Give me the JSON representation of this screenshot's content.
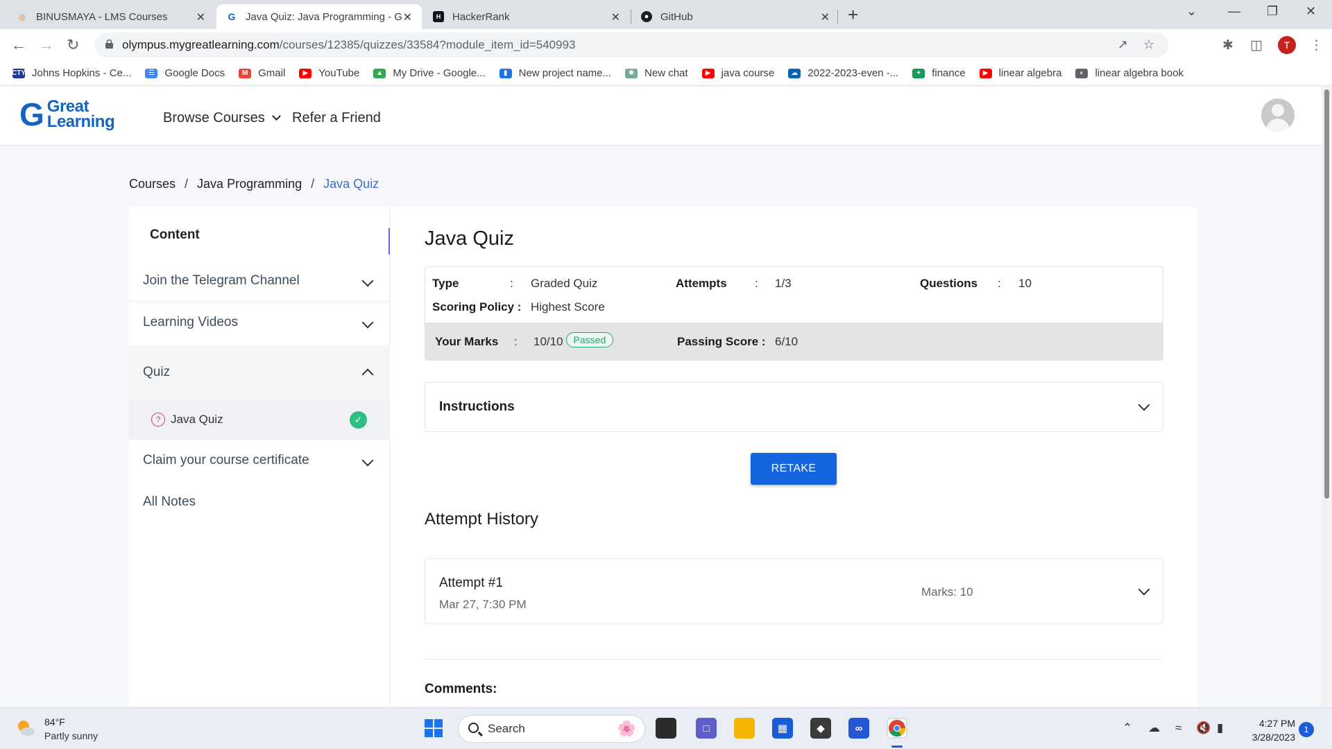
{
  "browser": {
    "tabs": [
      {
        "title": "BINUSMAYA - LMS Courses",
        "icon": "binusmaya-icon",
        "active": false
      },
      {
        "title": "Java Quiz: Java Programming - G",
        "icon": "greatlearning-icon",
        "active": true
      },
      {
        "title": "HackerRank",
        "icon": "hackerrank-icon",
        "active": false
      },
      {
        "title": "GitHub",
        "icon": "github-icon",
        "active": false
      }
    ],
    "url_host": "olympus.mygreatlearning.com",
    "url_path": "/courses/12385/quizzes/33584?module_item_id=540993",
    "profile_initial": "T",
    "bookmarks": [
      {
        "label": "Johns Hopkins - Ce...",
        "icon": "jhu-icon",
        "color": "#1f3a93"
      },
      {
        "label": "Google Docs",
        "icon": "docs-icon",
        "color": "#4285f4"
      },
      {
        "label": "Gmail",
        "icon": "gmail-icon",
        "color": "#ea4335"
      },
      {
        "label": "YouTube",
        "icon": "youtube-icon",
        "color": "#ff0000"
      },
      {
        "label": "My Drive - Google...",
        "icon": "drive-icon",
        "color": "#34a853"
      },
      {
        "label": "New project name...",
        "icon": "bookmark-icon",
        "color": "#1a73e8"
      },
      {
        "label": "New chat",
        "icon": "chatgpt-icon",
        "color": "#74aa9c"
      },
      {
        "label": "java course",
        "icon": "youtube-icon",
        "color": "#ff0000"
      },
      {
        "label": "2022-2023-even -...",
        "icon": "onedrive-icon",
        "color": "#0364b8"
      },
      {
        "label": "finance",
        "icon": "sheets-icon",
        "color": "#0f9d58"
      },
      {
        "label": "linear algebra",
        "icon": "youtube-icon",
        "color": "#ff0000"
      },
      {
        "label": "linear algebra book",
        "icon": "globe-icon",
        "color": "#5f6368"
      }
    ]
  },
  "site": {
    "logo_line1": "Great",
    "logo_line2": "Learning",
    "nav_browse": "Browse Courses",
    "nav_refer": "Refer a Friend"
  },
  "breadcrumb": {
    "items": [
      "Courses",
      "Java Programming"
    ],
    "current": "Java Quiz",
    "sep": "/"
  },
  "sidebar": {
    "title": "Content",
    "items": [
      {
        "label": "Join the Telegram Channel"
      },
      {
        "label": "Learning Videos"
      },
      {
        "label": "Quiz"
      },
      {
        "label": "Claim your course certificate"
      },
      {
        "label": "All Notes"
      }
    ],
    "sub_item": "Java Quiz"
  },
  "quiz": {
    "title": "Java Quiz",
    "type_label": "Type",
    "type_value": "Graded Quiz",
    "attempts_label": "Attempts",
    "attempts_value": "1/3",
    "questions_label": "Questions",
    "questions_value": "10",
    "scoring_label": "Scoring Policy :",
    "scoring_value": "Highest Score",
    "marks_label": "Your Marks",
    "marks_value": "10/10",
    "status_badge": "Passed",
    "passing_label": "Passing Score :",
    "passing_value": "6/10",
    "colon": ":",
    "instructions_label": "Instructions",
    "retake_label": "RETAKE",
    "history_title": "Attempt History",
    "attempt": {
      "name": "Attempt #1",
      "date": "Mar 27, 7:30 PM",
      "marks": "Marks: 10"
    },
    "comments_label": "Comments:"
  },
  "taskbar": {
    "temp": "84°F",
    "condition": "Partly sunny",
    "search_label": "Search",
    "time": "4:27 PM",
    "date": "3/28/2023",
    "notification_count": "1"
  },
  "colors": {
    "brand": "#1565c0",
    "accent_button": "#1565e0",
    "passed": "#2aa472",
    "collapse": "#5b6bdc"
  }
}
